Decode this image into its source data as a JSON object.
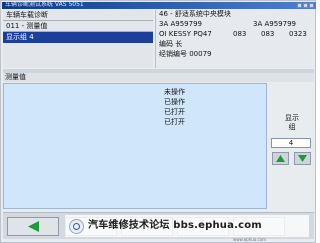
{
  "window": {
    "title": "车辆诊断测试系统 VAS 5051"
  },
  "left_panel": {
    "title": "车辆车载诊断",
    "function": "011 - 测量值",
    "display_group": "显示组 4"
  },
  "right_panel": {
    "module": "46 - 舒适系统中央模块",
    "part_number_1": "3A A959799",
    "part_number_2": "3A A959799",
    "component": "OI KESSY PQ47",
    "field_a": "083",
    "field_b": "083",
    "field_c": "0323",
    "coding_label": "编码 长",
    "dealer_label": "经销编号 00079"
  },
  "measured_values": {
    "label": "测量值",
    "lines": [
      "未操作",
      "已操作",
      "已打开",
      "已打开"
    ]
  },
  "group_control": {
    "label": "显示\n组",
    "value": "4",
    "up": "▲",
    "down": "▼"
  },
  "bottom": {
    "back_icon": "left-arrow-icon",
    "watermark": "汽车维修技术论坛 bbs.ephua.com",
    "footer": "www.ephua.com"
  },
  "colors": {
    "selected_row": "#1b3f9a",
    "value_area": "#cfe6fb",
    "arrow_green": "#1f9a3a"
  }
}
